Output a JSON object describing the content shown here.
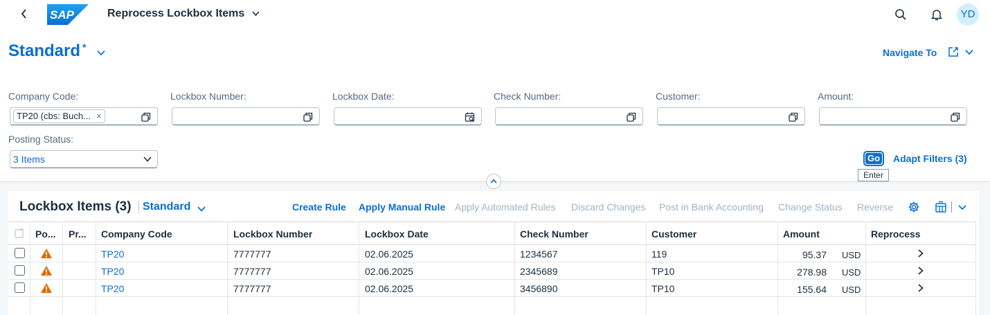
{
  "shell": {
    "logo_text": "SAP",
    "app_title": "Reprocess Lockbox Items",
    "avatar_initials": "YD"
  },
  "header": {
    "variant_name": "Standard",
    "variant_modified_marker": "*",
    "navigate_to_label": "Navigate To"
  },
  "filters": {
    "company_code": {
      "label": "Company Code:",
      "token": "TP20 (cbs: Buch...",
      "token_remove": "×"
    },
    "lockbox_number": {
      "label": "Lockbox Number:",
      "value": ""
    },
    "lockbox_date": {
      "label": "Lockbox Date:",
      "value": ""
    },
    "check_number": {
      "label": "Check Number:",
      "value": ""
    },
    "customer": {
      "label": "Customer:",
      "value": ""
    },
    "amount": {
      "label": "Amount:",
      "value": ""
    },
    "posting_status": {
      "label": "Posting Status:",
      "value": "3 Items"
    },
    "go_label": "Go",
    "go_tooltip": "Enter",
    "adapt_filters_label": "Adapt Filters (3)"
  },
  "table": {
    "title": "Lockbox Items (3)",
    "variant": "Standard",
    "actions": {
      "create_rule": "Create Rule",
      "apply_manual_rule": "Apply Manual Rule",
      "apply_automated_rules": "Apply Automated Rules",
      "discard_changes": "Discard Changes",
      "post_in_bank_accounting": "Post in Bank Accounting",
      "change_status": "Change Status",
      "reverse": "Reverse"
    },
    "columns": {
      "posting": "Po...",
      "processing": "Pr...",
      "company_code": "Company Code",
      "lockbox_number": "Lockbox Number",
      "lockbox_date": "Lockbox Date",
      "check_number": "Check Number",
      "customer": "Customer",
      "amount": "Amount",
      "reprocess": "Reprocess"
    },
    "rows": [
      {
        "company_code": "TP20",
        "lockbox_number": "7777777",
        "lockbox_date": "02.06.2025",
        "check_number": "1234567",
        "customer": "119",
        "amount": "95.37",
        "currency": "USD",
        "status_icon": "warning-icon"
      },
      {
        "company_code": "TP20",
        "lockbox_number": "7777777",
        "lockbox_date": "02.06.2025",
        "check_number": "2345689",
        "customer": "TP10",
        "amount": "278.98",
        "currency": "USD",
        "status_icon": "warning-icon"
      },
      {
        "company_code": "TP20",
        "lockbox_number": "7777777",
        "lockbox_date": "02.06.2025",
        "check_number": "3456890",
        "customer": "TP10",
        "amount": "155.64",
        "currency": "USD",
        "status_icon": "warning-icon"
      }
    ]
  },
  "colors": {
    "accent": "#0a6ed1",
    "warning": "#e76500",
    "text": "#1d2d3e",
    "disabled_action": "#9fb3c8"
  }
}
